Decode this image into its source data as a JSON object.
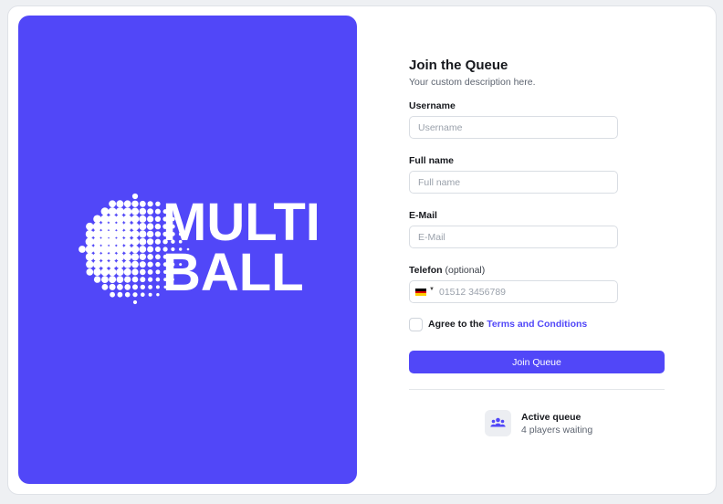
{
  "hero": {
    "logo_line1": "MULTI",
    "logo_line2": "BALL",
    "background": "#5147f8"
  },
  "form": {
    "title": "Join the Queue",
    "description": "Your custom description here.",
    "username": {
      "label": "Username",
      "placeholder": "Username",
      "value": ""
    },
    "fullname": {
      "label": "Full name",
      "placeholder": "Full name",
      "value": ""
    },
    "email": {
      "label": "E-Mail",
      "placeholder": "E-Mail",
      "value": ""
    },
    "phone": {
      "label": "Telefon",
      "optional": "(optional)",
      "placeholder": "01512 3456789",
      "value": "",
      "country_flag": "de-flag-icon"
    },
    "agree": {
      "prefix": "Agree to the",
      "terms_link": "Terms and Conditions",
      "checked": false
    },
    "join_label": "Join Queue"
  },
  "queue": {
    "icon": "users-icon",
    "title": "Active queue",
    "count_text": "4 players waiting"
  },
  "colors": {
    "accent": "#5147f8",
    "text": "#16181d",
    "muted": "#5d6470"
  }
}
